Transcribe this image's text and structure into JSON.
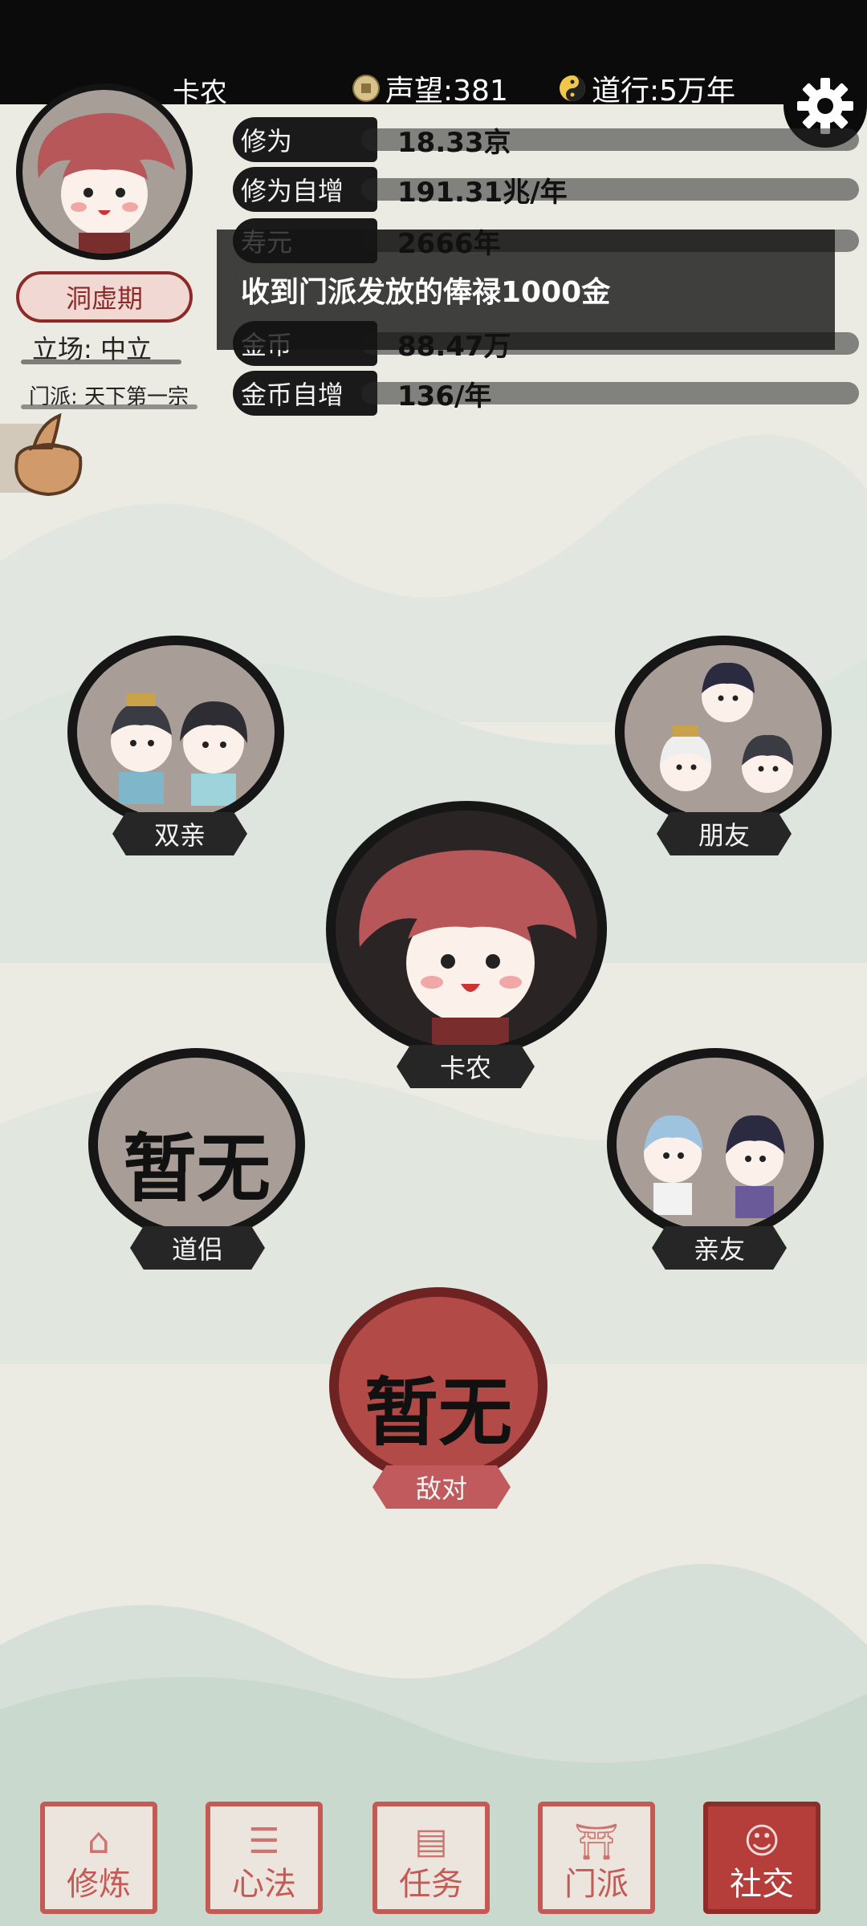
{
  "header": {
    "player_name": "卡农",
    "reputation_label": "声望:381",
    "dao_label": "道行:5万年"
  },
  "stats": [
    {
      "label": "修为",
      "value": "18.33京"
    },
    {
      "label": "修为自增",
      "value": "191.31兆/年"
    },
    {
      "label": "寿元",
      "value": "2666年"
    },
    {
      "label": "金币",
      "value": "88.47万"
    },
    {
      "label": "金币自增",
      "value": "136/年"
    }
  ],
  "realm": "洞虚期",
  "stance": "立场: 中立",
  "sect": "门派: 天下第一宗",
  "toast": "收到门派发放的俸禄1000金",
  "relations": {
    "parents": "双亲",
    "friends": "朋友",
    "self": "卡农",
    "partner": "道侣",
    "partner_value": "暂无",
    "relatives": "亲友",
    "enemy": "敌对",
    "enemy_value": "暂无"
  },
  "nav": [
    {
      "label": "修炼",
      "active": false
    },
    {
      "label": "心法",
      "active": false
    },
    {
      "label": "任务",
      "active": false
    },
    {
      "label": "门派",
      "active": false
    },
    {
      "label": "社交",
      "active": true
    }
  ],
  "colors": {
    "accent_red": "#c05a5c",
    "ink": "#161616",
    "paper": "#ecebe3"
  }
}
